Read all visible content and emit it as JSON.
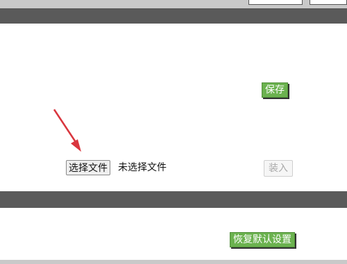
{
  "header": {},
  "settings": {
    "save_label": "保存"
  },
  "upload": {
    "choose_file_label": "选择文件",
    "file_status": "未选择文件",
    "load_label": "装入"
  },
  "restore": {
    "restore_defaults_label": "恢复默认设置"
  },
  "colors": {
    "accent_green": "#6bb24f",
    "band_gray": "#5a5a5a"
  }
}
